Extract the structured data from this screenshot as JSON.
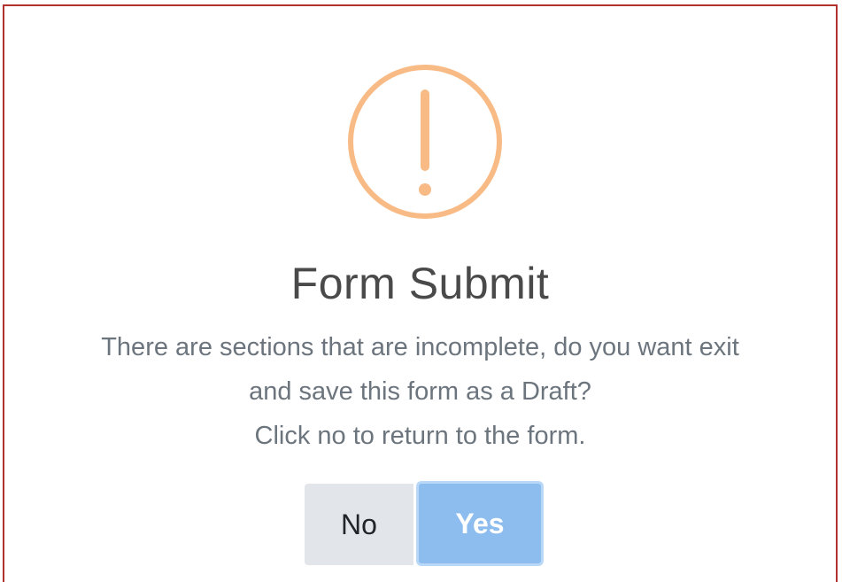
{
  "dialog": {
    "icon": "warning-exclamation-icon",
    "icon_color": "#f8bb86",
    "title": "Form Submit",
    "message_lines": [
      "There are sections that are incomplete, do you want exit",
      "and save this form as a Draft?",
      "Click no to return to the form."
    ],
    "buttons": {
      "no_label": "No",
      "yes_label": "Yes"
    }
  },
  "colors": {
    "frame_border": "#b3322f",
    "yes_button": "#8dbdef",
    "no_button": "#e2e6ea",
    "message_text": "#6c757d"
  }
}
